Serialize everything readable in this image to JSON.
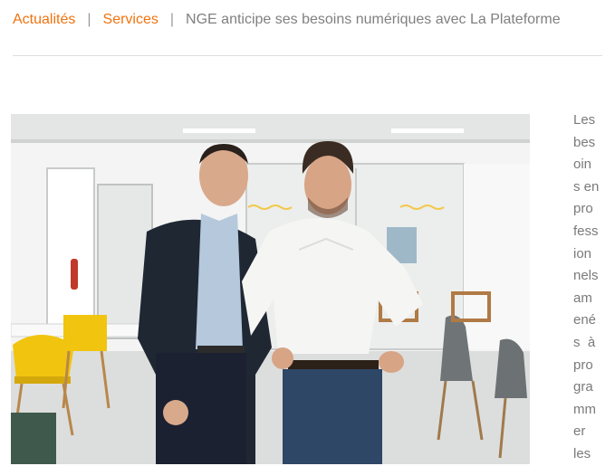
{
  "breadcrumb": {
    "item1": "Actualités",
    "separator": "|",
    "item2": "Services",
    "current": "NGE anticipe ses besoins numériques avec La Plateforme"
  },
  "colors": {
    "accent": "#f0730f",
    "text_muted": "#808080",
    "divider": "#dddddd"
  },
  "photo": {
    "description_icon": "photo-two-men-office"
  },
  "article": {
    "lines": [
      "Les",
      "bes",
      "oin",
      "s en",
      "pro",
      "fess",
      "ion",
      "nels",
      "am",
      "ené",
      "s  à",
      "pro",
      "gra",
      "mm",
      "er",
      "les"
    ]
  }
}
